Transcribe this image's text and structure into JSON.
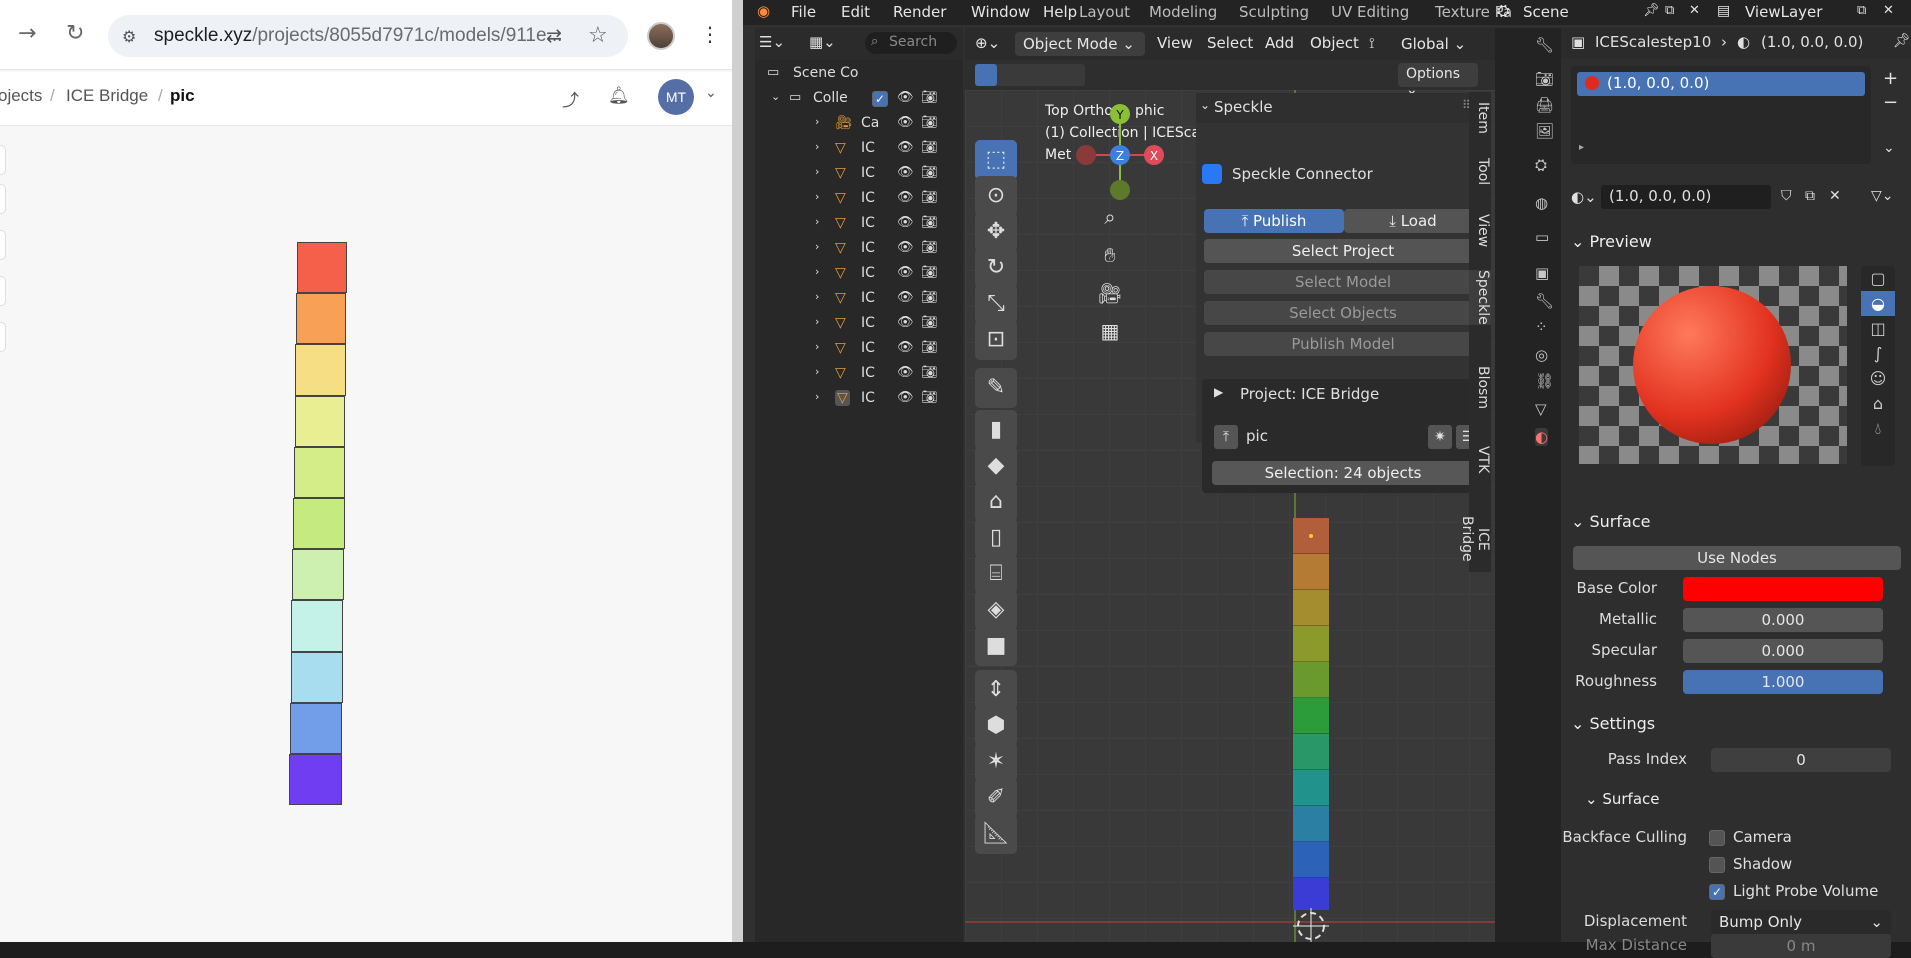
{
  "browser": {
    "url_host": "speckle.xyz",
    "url_path": "/projects/8055d7971c/models/911e...",
    "breadcrumbs": [
      "ojects",
      "ICE Bridge",
      "pic"
    ],
    "avatar_initials": "MT",
    "cells": [
      "#f5604a",
      "#f8a156",
      "#f6de85",
      "#e9ee92",
      "#d5ed88",
      "#c5eb80",
      "#cdefb0",
      "#c4f1e8",
      "#a8dcef",
      "#729ee9",
      "#6f3ef3"
    ]
  },
  "blender": {
    "menus": [
      "File",
      "Edit",
      "Render",
      "Window",
      "Help"
    ],
    "workspaces": [
      "Layout",
      "Modeling",
      "Sculpting",
      "UV Editing",
      "Texture Pa"
    ],
    "scene": "Scene",
    "view_layer": "ViewLayer",
    "outliner": {
      "search_placeholder": "Search",
      "root": "Scene Co",
      "collection": "Colle",
      "camera_label": "Ca",
      "mesh_label": "IC"
    },
    "viewport": {
      "mode": "Object Mode",
      "menus": [
        "View",
        "Select",
        "Add",
        "Object"
      ],
      "transform": "Global",
      "options": "Options",
      "overlay_line1": "Top Ortho",
      "overlay_line1b": "phic",
      "overlay_line2": "(1) Collection | ICESca",
      "overlay_line3": "Met",
      "gizmo": {
        "y": "Y",
        "z": "Z",
        "x": "X"
      },
      "bar_cells": [
        "#b15f3a",
        "#b47b35",
        "#a48d2f",
        "#8c9a2c",
        "#6a9a2e",
        "#2c9b3a",
        "#2a9768",
        "#22928d",
        "#2a7fa2",
        "#2c62b7"
      ]
    },
    "speckle": {
      "title": "Speckle",
      "connector": "Speckle Connector",
      "publish": "Publish",
      "load": "Load",
      "select_project": "Select Project",
      "select_model": "Select Model",
      "select_objects": "Select Objects",
      "publish_model": "Publish Model",
      "project_label": "Project: ICE Bridge",
      "model_name": "pic",
      "selection": "Selection: 24 objects"
    },
    "side_tabs": [
      "Item",
      "Tool",
      "View",
      "Speckle",
      "Blosm",
      "VTK",
      "ICE Bridge"
    ],
    "properties": {
      "object_name": "ICEScalestep10",
      "material_name": "(1.0, 0.0, 0.0)",
      "slot_name": "(1.0, 0.0, 0.0)",
      "material_field": "(1.0, 0.0, 0.0)",
      "preview_label": "Preview",
      "surface_label": "Surface",
      "use_nodes": "Use Nodes",
      "base_color_label": "Base Color",
      "base_color": "#ff0000",
      "metallic_label": "Metallic",
      "metallic": "0.000",
      "specular_label": "Specular",
      "specular": "0.000",
      "roughness_label": "Roughness",
      "roughness": "1.000",
      "settings_label": "Settings",
      "pass_index_label": "Pass Index",
      "pass_index": "0",
      "surface_sub_label": "Surface",
      "backface_label": "Backface Culling",
      "camera_label": "Camera",
      "shadow_label": "Shadow",
      "light_probe_label": "Light Probe Volume",
      "displacement_label": "Displacement",
      "displacement": "Bump Only",
      "max_distance_label": "Max Distance",
      "max_distance": "0 m"
    }
  }
}
